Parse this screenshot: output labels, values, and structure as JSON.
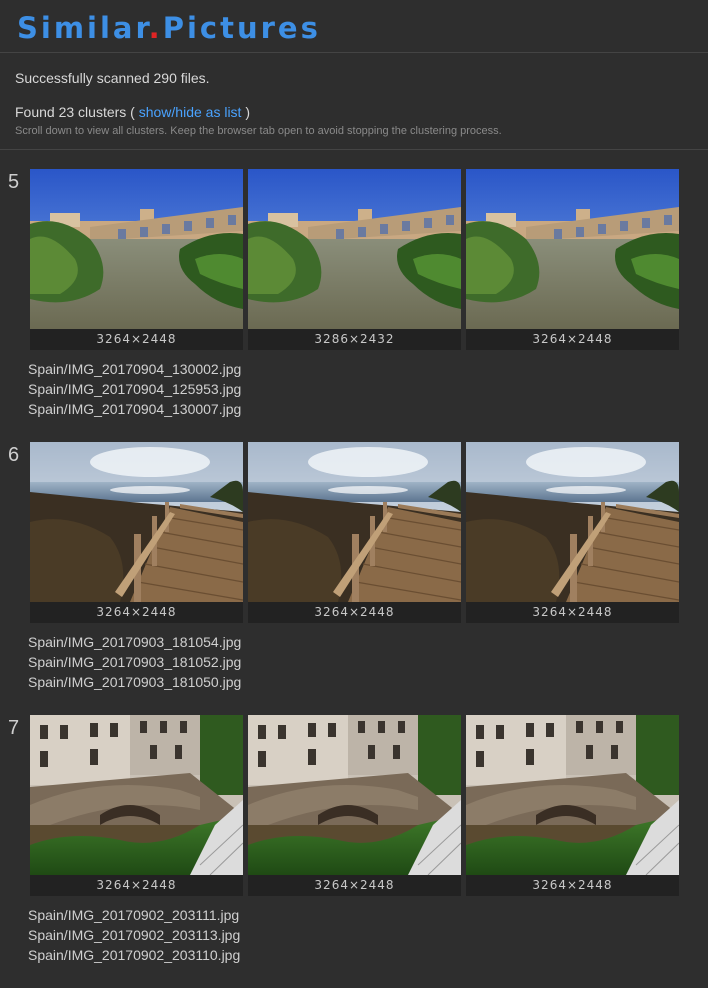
{
  "brand": {
    "part1": "Similar",
    "dot": ".",
    "part2": "Pictures"
  },
  "summary": {
    "scanned": "Successfully scanned 290 files.",
    "found_prefix": "Found 23 clusters (",
    "toggle_link": "show/hide as list",
    "found_suffix": ")",
    "hint": "Scroll down to view all clusters. Keep the browser tab open to avoid stopping the clustering process."
  },
  "clusters": [
    {
      "number": "5",
      "images": [
        {
          "dims": "3264×2448",
          "scene": "river-bridge"
        },
        {
          "dims": "3286×2432",
          "scene": "river-bridge"
        },
        {
          "dims": "3264×2448",
          "scene": "river-bridge"
        }
      ],
      "files": [
        "Spain/IMG_20170904_130002.jpg",
        "Spain/IMG_20170904_125953.jpg",
        "Spain/IMG_20170904_130007.jpg"
      ]
    },
    {
      "number": "6",
      "images": [
        {
          "dims": "3264×2448",
          "scene": "boardwalk-sea"
        },
        {
          "dims": "3264×2448",
          "scene": "boardwalk-sea"
        },
        {
          "dims": "3264×2448",
          "scene": "boardwalk-sea"
        }
      ],
      "files": [
        "Spain/IMG_20170903_181054.jpg",
        "Spain/IMG_20170903_181052.jpg",
        "Spain/IMG_20170903_181050.jpg"
      ]
    },
    {
      "number": "7",
      "images": [
        {
          "dims": "3264×2448",
          "scene": "stone-bridge-town"
        },
        {
          "dims": "3264×2448",
          "scene": "stone-bridge-town"
        },
        {
          "dims": "3264×2448",
          "scene": "stone-bridge-town"
        }
      ],
      "files": [
        "Spain/IMG_20170902_203111.jpg",
        "Spain/IMG_20170902_203113.jpg",
        "Spain/IMG_20170902_203110.jpg"
      ]
    }
  ]
}
